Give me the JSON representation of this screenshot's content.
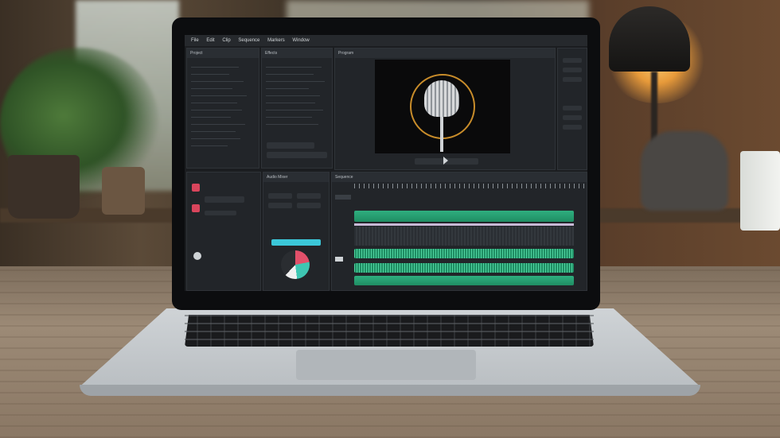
{
  "app": {
    "menu_items": [
      "File",
      "Edit",
      "Clip",
      "Sequence",
      "Markers",
      "Window"
    ],
    "project_panel_title": "Project",
    "effects_panel_title": "Effects",
    "preview_panel_title": "Program",
    "timeline_title": "Sequence",
    "mixer_title": "Audio Mixer"
  },
  "colors": {
    "track_green": "#2fae7f",
    "mic_ring": "#c88c2a",
    "cyan_control": "#3bc7d8",
    "pie_red": "#e2506a",
    "pie_teal": "#3ec6b2"
  },
  "icons": [
    "microphone-icon",
    "play-icon",
    "scissors-icon",
    "speaker-icon"
  ]
}
